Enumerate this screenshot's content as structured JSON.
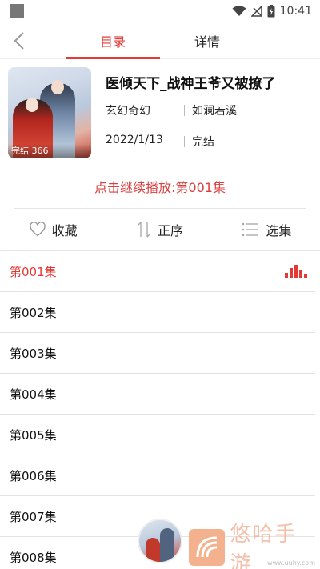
{
  "statusbar": {
    "time": "10:41"
  },
  "nav": {
    "tab_catalog": "目录",
    "tab_details": "详情"
  },
  "book": {
    "title": "医倾天下_战神王爷又被撩了",
    "genre": "玄幻奇幻",
    "author": "如澜若溪",
    "date": "2022/1/13",
    "status": "完结",
    "cover_badge": "完结 366"
  },
  "continue_play": "点击继续播放:第001集",
  "actions": {
    "favorite": "收藏",
    "order": "正序",
    "select": "选集"
  },
  "episodes": [
    {
      "label": "第001集",
      "playing": true
    },
    {
      "label": "第002集"
    },
    {
      "label": "第003集"
    },
    {
      "label": "第004集"
    },
    {
      "label": "第005集"
    },
    {
      "label": "第006集"
    },
    {
      "label": "第007集"
    },
    {
      "label": "第008集"
    }
  ],
  "watermark": {
    "text": "悠哈手游",
    "url": "www.uuhy.com"
  },
  "colors": {
    "accent": "#e53935",
    "continue": "#d84040"
  },
  "icons": [
    "back-icon",
    "heart-icon",
    "sort-icon",
    "list-icon",
    "playing-bars-icon",
    "wifi-icon",
    "signal-icon",
    "battery-icon"
  ]
}
